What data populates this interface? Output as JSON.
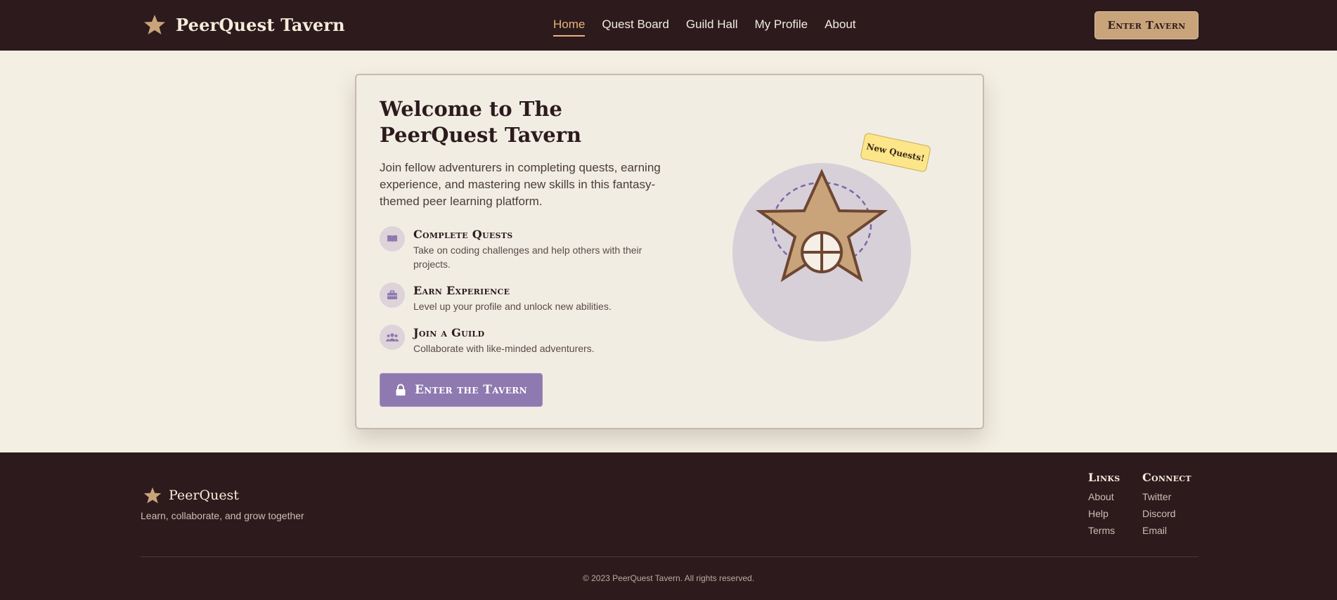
{
  "header": {
    "brand": "PeerQuest Tavern",
    "nav": [
      {
        "label": "Home",
        "active": true
      },
      {
        "label": "Quest Board",
        "active": false
      },
      {
        "label": "Guild Hall",
        "active": false
      },
      {
        "label": "My Profile",
        "active": false
      },
      {
        "label": "About",
        "active": false
      }
    ],
    "enter_button": "Enter Tavern"
  },
  "hero": {
    "title": "Welcome to The PeerQuest Tavern",
    "intro": "Join fellow adventurers in completing quests, earning experience, and mastering new skills in this fantasy-themed peer learning platform.",
    "features": [
      {
        "icon": "book-icon",
        "title": "Complete Quests",
        "text": "Take on coding challenges and help others with their projects."
      },
      {
        "icon": "briefcase-icon",
        "title": "Earn Experience",
        "text": "Level up your profile and unlock new abilities."
      },
      {
        "icon": "users-icon",
        "title": "Join a Guild",
        "text": "Collaborate with like-minded adventurers."
      }
    ],
    "cta": "Enter the Tavern",
    "badge": "New Quests!"
  },
  "footer": {
    "brand": "PeerQuest",
    "tagline": "Learn, collaborate, and grow together",
    "links_title": "Links",
    "links": [
      "About",
      "Help",
      "Terms"
    ],
    "connect_title": "Connect",
    "connect": [
      "Twitter",
      "Discord",
      "Email"
    ],
    "copyright": "© 2023 PeerQuest Tavern. All rights reserved."
  },
  "colors": {
    "dark": "#2c1a1d",
    "background": "#f3efe3",
    "accent_gold": "#c9a37a",
    "accent_purple": "#8e79b0",
    "badge_yellow": "#fde58a"
  }
}
